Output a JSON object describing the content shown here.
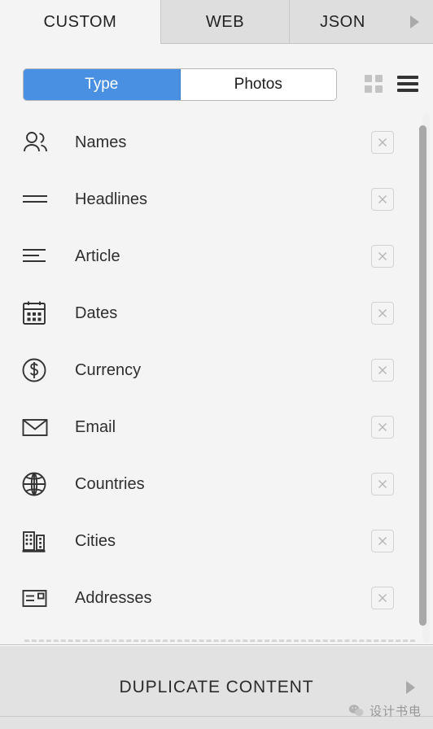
{
  "tabs": {
    "items": [
      {
        "label": "CUSTOM",
        "active": true
      },
      {
        "label": "WEB",
        "active": false
      },
      {
        "label": "JSON",
        "active": false
      }
    ],
    "overflow_icon": "triangle-right-icon"
  },
  "toolbar": {
    "segments": [
      {
        "label": "Type",
        "active": true
      },
      {
        "label": "Photos",
        "active": false
      }
    ],
    "accent_color": "#4a90e2",
    "views": [
      {
        "name": "grid-view",
        "icon": "grid-icon",
        "active": false
      },
      {
        "name": "list-view",
        "icon": "list-icon",
        "active": true
      }
    ]
  },
  "list": {
    "remove_icon": "close-icon",
    "items": [
      {
        "label": "Names",
        "icon": "people-icon"
      },
      {
        "label": "Headlines",
        "icon": "two-lines-icon"
      },
      {
        "label": "Article",
        "icon": "text-lines-icon"
      },
      {
        "label": "Dates",
        "icon": "calendar-icon"
      },
      {
        "label": "Currency",
        "icon": "dollar-circle-icon"
      },
      {
        "label": "Email",
        "icon": "envelope-icon"
      },
      {
        "label": "Countries",
        "icon": "globe-icon"
      },
      {
        "label": "Cities",
        "icon": "buildings-icon"
      },
      {
        "label": "Addresses",
        "icon": "address-card-icon"
      }
    ]
  },
  "bottom_bar": {
    "label": "DUPLICATE CONTENT",
    "arrow_icon": "triangle-right-icon"
  },
  "watermark": {
    "text": "设计书电",
    "icon": "wechat-icon"
  }
}
